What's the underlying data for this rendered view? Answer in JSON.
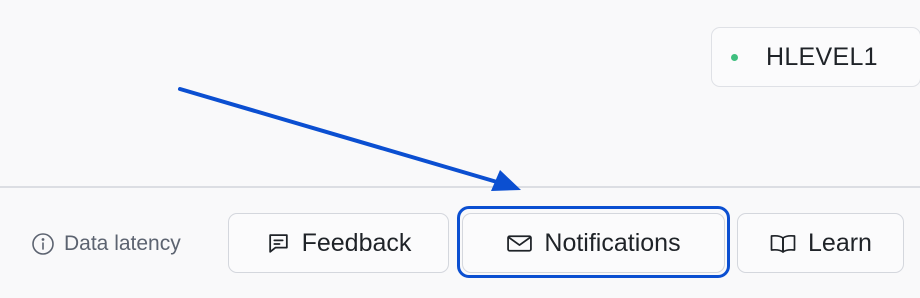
{
  "header": {
    "org_badge": {
      "status_color": "#3fbf7f",
      "label": "HLEVEL1"
    }
  },
  "footer": {
    "latency": {
      "icon": "info-circle-icon",
      "label": "Data latency"
    },
    "buttons": {
      "feedback": {
        "icon": "message-square-icon",
        "label": "Feedback"
      },
      "notifications": {
        "icon": "mail-icon",
        "label": "Notifications"
      },
      "learn": {
        "icon": "open-book-icon",
        "label": "Learn"
      }
    }
  },
  "annotation": {
    "color": "#0b4fd1",
    "target": "notifications-button"
  }
}
